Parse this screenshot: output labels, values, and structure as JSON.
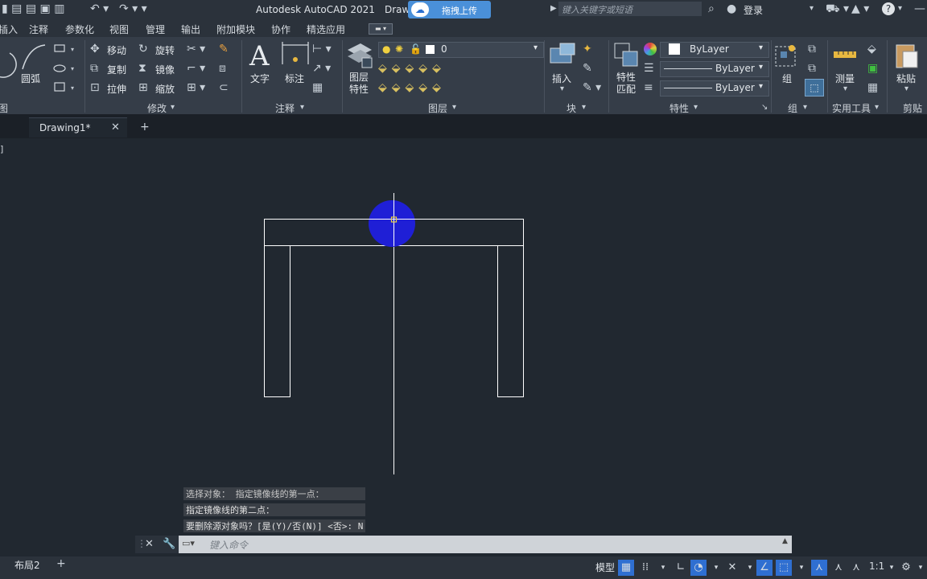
{
  "app": {
    "title": "Autodesk AutoCAD 2021",
    "drawing_title_partial": "Draw",
    "upload_label": "拖拽上传"
  },
  "search": {
    "placeholder": "键入关键字或短语"
  },
  "account": {
    "login_label": "登录"
  },
  "menu": {
    "items": [
      "插入",
      "注释",
      "参数化",
      "视图",
      "管理",
      "输出",
      "附加模块",
      "协作",
      "精选应用"
    ]
  },
  "draw_panel": {
    "arc_label": "圆弧",
    "title": "图"
  },
  "modify_panel": {
    "move": "移动",
    "rotate": "旋转",
    "copy": "复制",
    "mirror": "镜像",
    "stretch": "拉伸",
    "scale": "缩放",
    "title": "修改"
  },
  "annotation_panel": {
    "text": "文字",
    "dimension": "标注",
    "title": "注释"
  },
  "layers_panel": {
    "layer_props": "图层\n特性",
    "current_layer": "0",
    "title": "图层"
  },
  "block_panel": {
    "insert": "插入",
    "title": "块"
  },
  "properties_panel": {
    "match": "特性\n匹配",
    "color": "ByLayer",
    "linetype": "ByLayer",
    "lineweight": "ByLayer",
    "title": "特性"
  },
  "group_panel": {
    "group": "组",
    "title": "组"
  },
  "utilities_panel": {
    "measure": "测量",
    "title": "实用工具"
  },
  "clipboard_panel": {
    "paste": "粘贴",
    "title": "剪贴"
  },
  "tabs": {
    "drawing_tab": "Drawing1*",
    "add": "+"
  },
  "viewport": {
    "corner_label": "]"
  },
  "command": {
    "history": [
      "选择对象： 指定镜像线的第一点：",
      "指定镜像线的第二点：",
      "要删除源对象吗？[是(Y)/否(N)] <否>: N"
    ],
    "placeholder": "键入命令"
  },
  "status": {
    "layout_tab": "布局2",
    "add": "+",
    "model": "模型",
    "scale": "1:1"
  },
  "colors": {
    "background": "#212830",
    "ribbon": "#353d48",
    "accent": "#2f6fd1",
    "grip": "#1f1fd6"
  }
}
